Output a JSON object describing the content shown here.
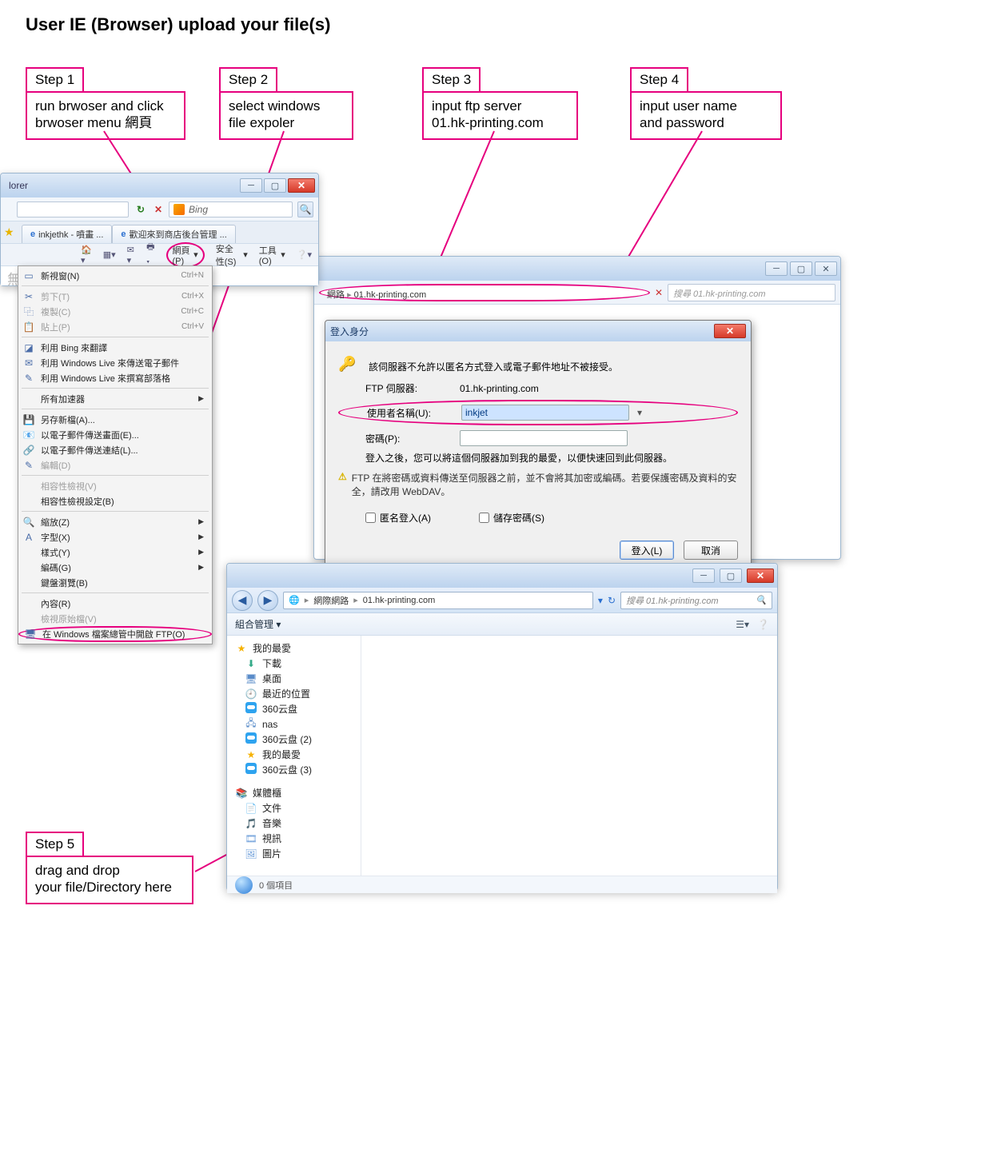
{
  "title": "User IE (Browser) upload your file(s)",
  "steps": {
    "s1": {
      "tag": "Step 1",
      "body": "run brwoser and click\nbrwoser menu 網頁"
    },
    "s2": {
      "tag": "Step 2",
      "body": "select windows\nfile expoler"
    },
    "s3": {
      "tag": "Step 3",
      "body": "input ftp server\n01.hk-printing.com"
    },
    "s4": {
      "tag": "Step 4",
      "body": "input user name\nand password"
    },
    "s5": {
      "tag": "Step 5",
      "body": "drag and drop\nyour file/Directory here"
    }
  },
  "ie": {
    "caption_fragment": "lorer",
    "bing_label": "Bing",
    "tabs": {
      "t1": "inkjethk - 噴畫 ...",
      "t2": "歡迎來到商店後台管理 ..."
    },
    "toolbar": {
      "home_drop": "▾",
      "feed": "▾",
      "mail": "▾",
      "page": "網頁(P)",
      "safety": "安全性(S)",
      "tools": "工具(O)",
      "help": "❔"
    },
    "content_placeholder": "無",
    "menu": {
      "new_window": "新視窗(N)",
      "new_window_sc": "Ctrl+N",
      "cut": "剪下(T)",
      "cut_sc": "Ctrl+X",
      "copy": "複製(C)",
      "copy_sc": "Ctrl+C",
      "paste": "貼上(P)",
      "paste_sc": "Ctrl+V",
      "bing_translate": "利用 Bing 來翻譯",
      "wl_mail": "利用 Windows Live 來傳送電子郵件",
      "wl_blog": "利用 Windows Live 來撰寫部落格",
      "accelerators": "所有加速器",
      "save_as": "另存新檔(A)...",
      "send_page": "以電子郵件傳送畫面(E)...",
      "send_link": "以電子郵件傳送連結(L)...",
      "edit": "編輯(D)",
      "compat_view": "相容性檢視(V)",
      "compat_settings": "相容性檢視設定(B)",
      "zoom": "縮放(Z)",
      "text_size": "字型(X)",
      "style": "樣式(Y)",
      "encoding": "編碼(G)",
      "caret": "鍵盤瀏覽(B)",
      "properties": "內容(R)",
      "view_source": "檢視原始檔(V)",
      "ftp_explorer": "在 Windows 檔案總管中開啟 FTP(O)"
    }
  },
  "login_bg": {
    "crumb_net": "網路",
    "crumb_site": "01.hk-printing.com",
    "search_ph": "搜尋 01.hk-printing.com"
  },
  "dialog": {
    "title": "登入身分",
    "msg": "該伺服器不允許以匿名方式登入或電子郵件地址不被接受。",
    "server_label": "FTP 伺服器:",
    "server_value": "01.hk-printing.com",
    "user_label": "使用者名稱(U):",
    "user_value": "inkjet",
    "pass_label": "密碼(P):",
    "after_login": "登入之後，您可以將這個伺服器加到我的最愛，以便快速回到此伺服器。",
    "warn": "FTP 在將密碼或資料傳送至伺服器之前，並不會將其加密或編碼。若要保護密碼及資料的安全，請改用 WebDAV。",
    "anon": "匿名登入(A)",
    "save_pw": "儲存密碼(S)",
    "login_btn": "登入(L)",
    "cancel_btn": "取消"
  },
  "explorer": {
    "crumb_net": "網際網路",
    "crumb_site": "01.hk-printing.com",
    "search_ph": "搜尋 01.hk-printing.com",
    "org_label": "組合管理 ▾",
    "side_fav": "我的最愛",
    "side_downloads": "下載",
    "side_desktop": "桌面",
    "side_recent": "最近的位置",
    "side_360": "360云盘",
    "side_nas": "nas",
    "side_360_2": "360云盘 (2)",
    "side_fav2": "我的最愛",
    "side_360_3": "360云盘 (3)",
    "side_lib": "媒體櫃",
    "side_docs": "文件",
    "side_music": "音樂",
    "side_video": "視訊",
    "side_pic": "圖片",
    "status": "0 個項目"
  }
}
